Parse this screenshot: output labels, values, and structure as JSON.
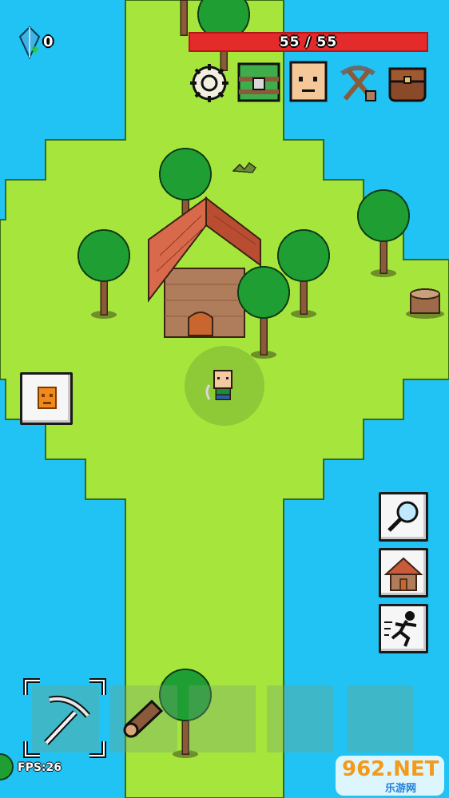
{
  "hud": {
    "gem_count": "0",
    "health_text": "55 / 55",
    "fps_text": "FPS:26"
  },
  "top_menu": {
    "items": [
      "settings",
      "chest",
      "character",
      "crafting",
      "backpack"
    ]
  },
  "side_buttons": {
    "left": "quest-mask",
    "right": [
      "search",
      "build",
      "sprint"
    ]
  },
  "hotbar": {
    "selected_tool": "pickaxe",
    "items": [
      "pickaxe",
      "log",
      "",
      "",
      ""
    ]
  },
  "watermark": {
    "big": "962.NET",
    "small": "乐游网"
  },
  "colors": {
    "water": "#20c3f3",
    "grass": "#a6e63c",
    "health": "#e42a2a",
    "roof": "#c95a3c",
    "wall": "#b07d5c"
  }
}
